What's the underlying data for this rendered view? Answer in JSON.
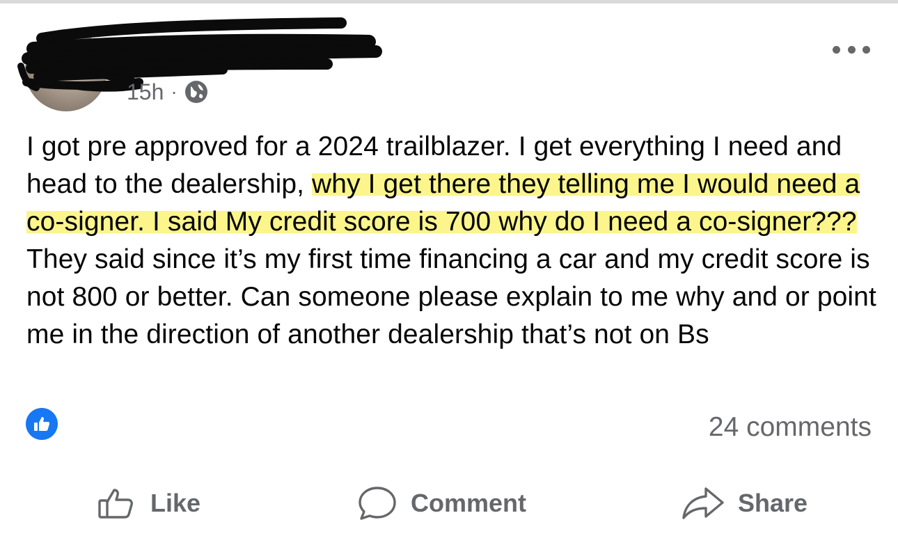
{
  "post": {
    "timestamp": "15h",
    "separator": "·",
    "privacy_icon": "globe-icon",
    "menu_icon": "more-horizontal-icon",
    "author_name_redacted": true,
    "body_segments": [
      {
        "text": "I got pre approved for a 2024 trailblazer. I get everything I need and head to the dealership, ",
        "highlighted": false
      },
      {
        "text": "why I get there they telling me I would need a co-signer. I said My credit score is 700 why do I need a co-signer???",
        "highlighted": true
      },
      {
        "text": " They said since it’s my first time financing a car and my credit score is not 800 or better. Can someone please explain to me why and or point me in the direction of another dealership that’s not on Bs",
        "highlighted": false
      }
    ],
    "reaction_icon": "like-reaction-icon",
    "comments_count": "24 comments"
  },
  "actions": {
    "like_label": "Like",
    "comment_label": "Comment",
    "share_label": "Share"
  },
  "colors": {
    "highlight": "#fbf58c",
    "secondary_text": "#65676b",
    "like_blue": "#1877f2"
  }
}
